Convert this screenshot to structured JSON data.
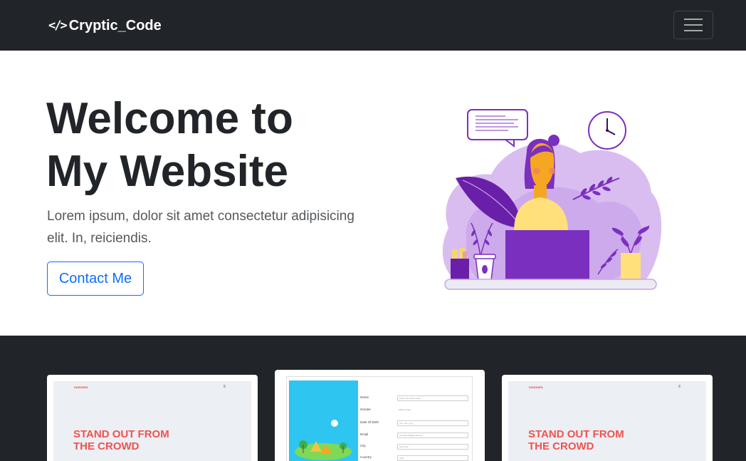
{
  "nav": {
    "brand_icon": "</>",
    "brand": "Cryptic_Code",
    "toggler_icon": "menu-icon"
  },
  "hero": {
    "title_line1": "Welcome to",
    "title_line2": "My Website",
    "text": "Lorem ipsum, dolor sit amet consectetur adipisicing elit. In, reiciendis.",
    "button": "Contact Me"
  },
  "colors": {
    "navbar": "#212529",
    "accent": "#0d6efd",
    "purple": "#7b2fbf",
    "lavender": "#c9a6e6",
    "project_title_red": "#ef5350"
  },
  "projects": [
    {
      "logo": "DIGIDDEN",
      "menu": "≡",
      "title_line1": "STAND OUT FROM",
      "title_line2": "THE CROWD"
    },
    {
      "form": {
        "rows": [
          {
            "label": "Name",
            "value": "Enter Your Name Here"
          },
          {
            "label": "Gender",
            "value": "Male   Female"
          },
          {
            "label": "Date Of Birth",
            "value": "mm / dd / yyyy"
          },
          {
            "label": "Email",
            "value": "example123@gmail.com"
          },
          {
            "label": "City",
            "value": "New York"
          },
          {
            "label": "Country",
            "value": "USA"
          }
        ]
      }
    },
    {
      "logo": "DIGIDDEN",
      "menu": "≡",
      "title_line1": "STAND OUT FROM",
      "title_line2": "THE CROWD"
    }
  ]
}
